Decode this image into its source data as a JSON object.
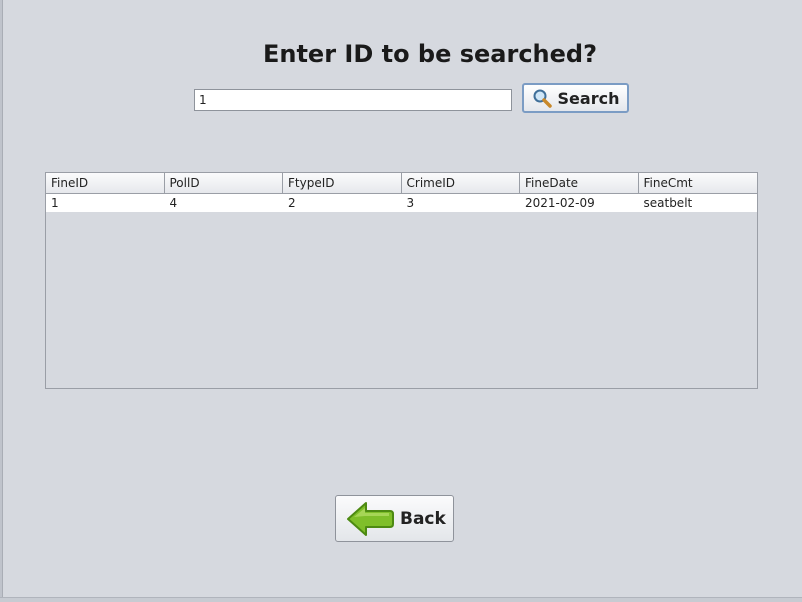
{
  "title": "Enter ID to be searched?",
  "search": {
    "value": "1",
    "button_label": "Search",
    "icon": "magnifier-icon"
  },
  "table": {
    "columns": [
      "FineID",
      "PollD",
      "FtypeID",
      "CrimeID",
      "FineDate",
      "FineCmt"
    ],
    "rows": [
      [
        "1",
        "4",
        "2",
        "3",
        "2021-02-09",
        "seatbelt"
      ]
    ]
  },
  "back": {
    "label": "Back",
    "icon": "green-left-arrow-icon"
  },
  "colors": {
    "background": "#d6d9df",
    "button_focus_border": "#7b9cc4",
    "arrow_green": "#7fbf2a"
  }
}
